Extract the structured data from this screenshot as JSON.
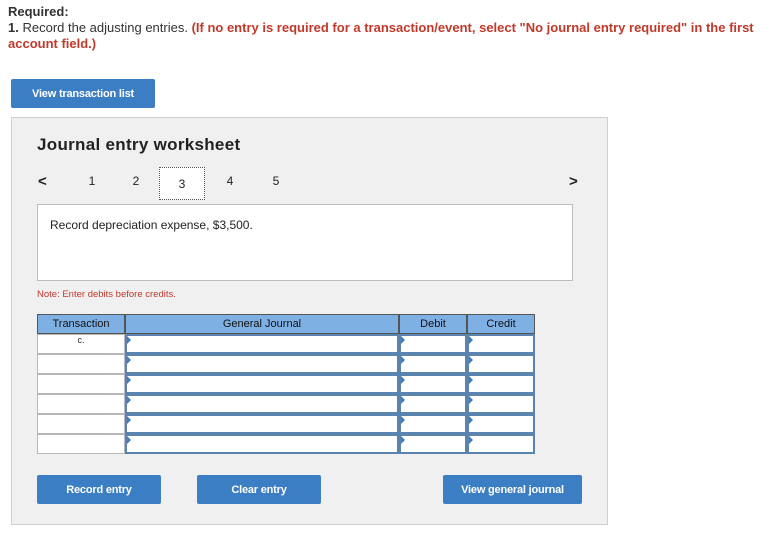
{
  "header": {
    "required_label": "Required:",
    "instruction_number": "1.",
    "instruction_text": "Record the adjusting entries.",
    "instruction_note": "(If no entry is required for a transaction/event, select \"No journal entry required\" in the first account field.)"
  },
  "buttons": {
    "view_transaction_list": "View transaction list",
    "record_entry": "Record entry",
    "clear_entry": "Clear entry",
    "view_general_journal": "View general journal"
  },
  "worksheet": {
    "title": "Journal entry worksheet",
    "pages": [
      "1",
      "2",
      "3",
      "4",
      "5"
    ],
    "active_page": "3",
    "prev_icon": "chevron-left",
    "next_icon": "chevron-right",
    "description": "Record depreciation expense, $3,500.",
    "note": "Note: Enter debits before credits."
  },
  "table": {
    "headers": [
      "Transaction",
      "General Journal",
      "Debit",
      "Credit"
    ],
    "rows": [
      {
        "transaction": "c.",
        "account": "",
        "debit": "",
        "credit": ""
      },
      {
        "transaction": "",
        "account": "",
        "debit": "",
        "credit": ""
      },
      {
        "transaction": "",
        "account": "",
        "debit": "",
        "credit": ""
      },
      {
        "transaction": "",
        "account": "",
        "debit": "",
        "credit": ""
      },
      {
        "transaction": "",
        "account": "",
        "debit": "",
        "credit": ""
      },
      {
        "transaction": "",
        "account": "",
        "debit": "",
        "credit": ""
      }
    ]
  },
  "colors": {
    "button_blue": "#3c7ec4",
    "header_blue": "#7fb0e3",
    "instruction_red": "#c0392b"
  }
}
